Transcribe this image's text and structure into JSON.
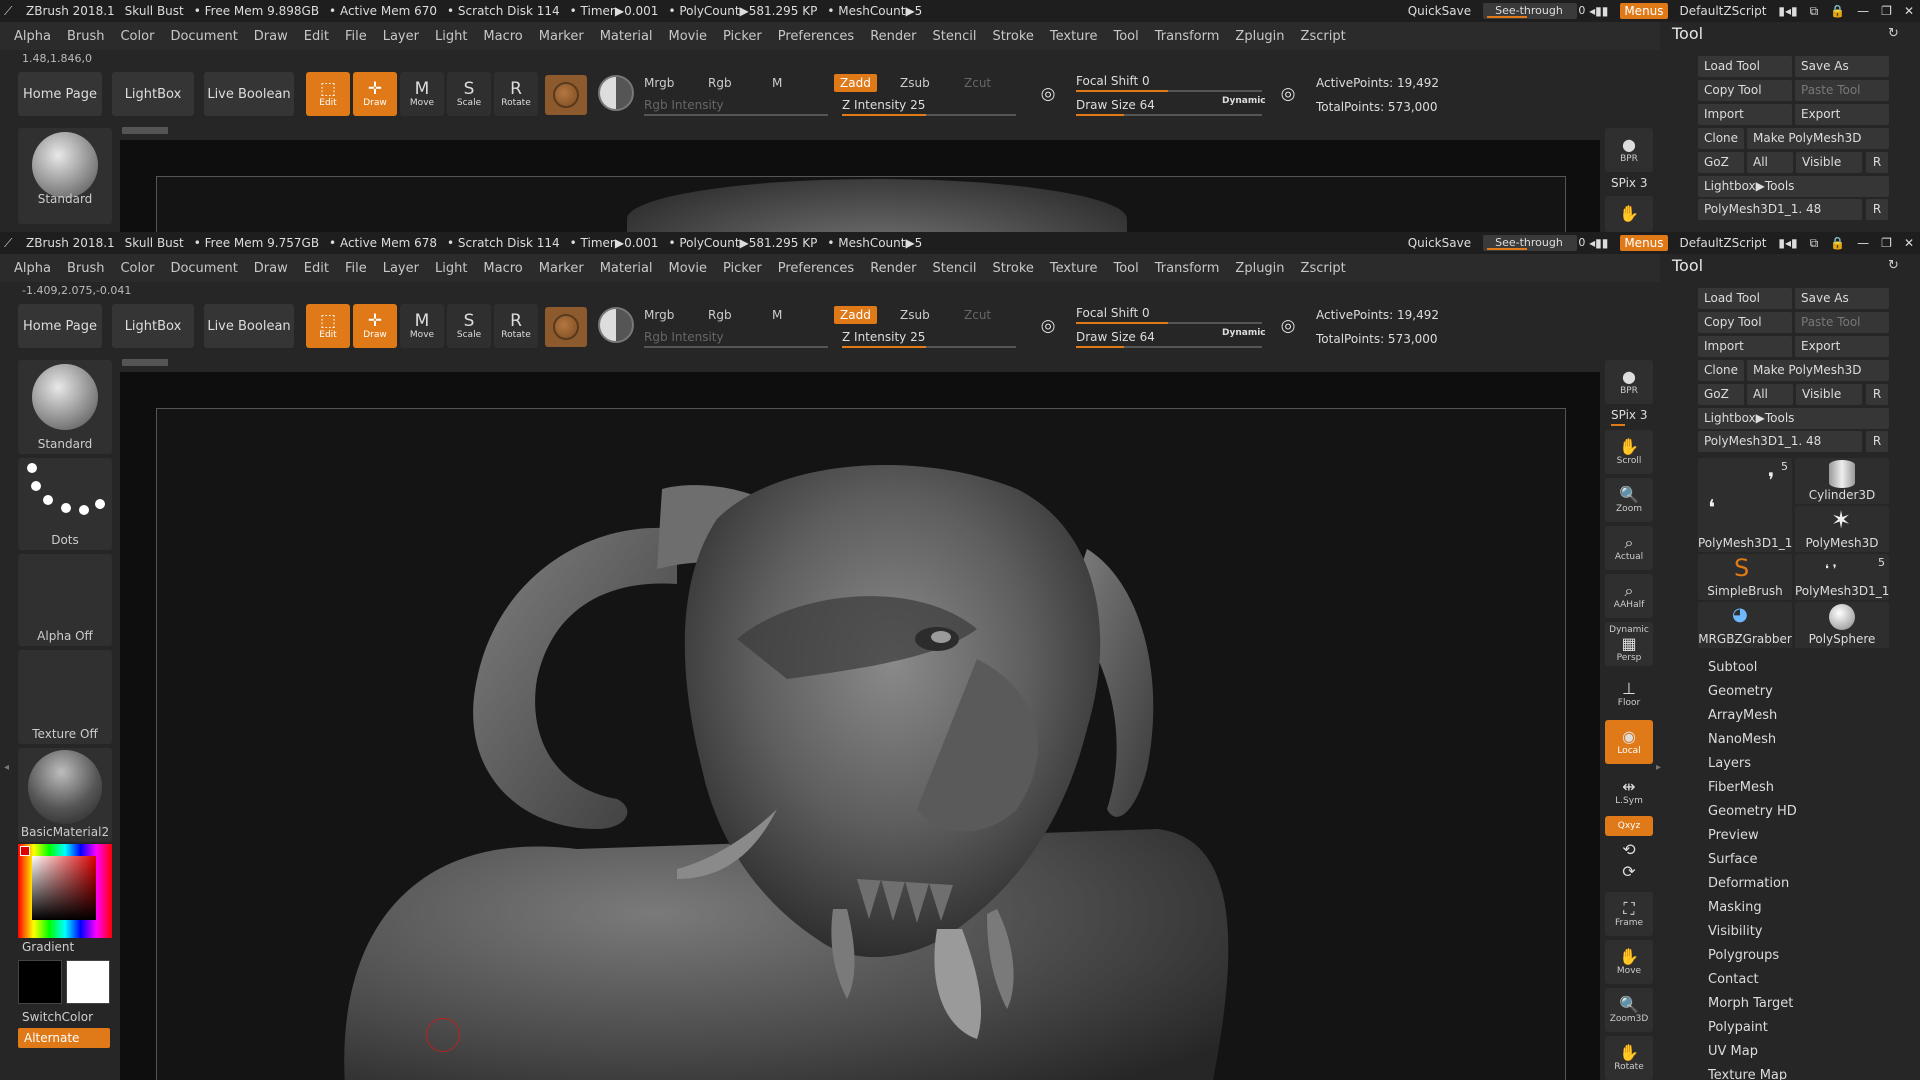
{
  "titlebar": {
    "app": "ZBrush 2018.1",
    "doc": "Skull Bust",
    "free_mem_top": "• Free Mem 9.898GB",
    "free_mem_bottom": "• Free Mem 9.757GB",
    "active_mem_top": "• Active Mem 670",
    "active_mem_bottom": "• Active Mem 678",
    "scratch": "• Scratch Disk 114",
    "timer": "• Timer▶0.001",
    "polycount": "• PolyCount▶581.295 KP",
    "meshcount": "• MeshCount▶5",
    "quicksave": "QuickSave",
    "seethrough_label": "See-through",
    "seethrough_value": "0",
    "menus": "Menus",
    "defaultzscript": "DefaultZScript"
  },
  "menubar": [
    "Alpha",
    "Brush",
    "Color",
    "Document",
    "Draw",
    "Edit",
    "File",
    "Layer",
    "Light",
    "Macro",
    "Marker",
    "Material",
    "Movie",
    "Picker",
    "Preferences",
    "Render",
    "Stencil",
    "Stroke",
    "Texture",
    "Tool",
    "Transform",
    "Zplugin",
    "Zscript"
  ],
  "coords": {
    "top": "1.48,1.846,0",
    "bottom": "-1.409,2.075,-0.041"
  },
  "toolbar": {
    "home": "Home Page",
    "lightbox": "LightBox",
    "liveboolean": "Live Boolean",
    "edit": "Edit",
    "draw": "Draw",
    "move": "Move",
    "scale": "Scale",
    "rotate": "Rotate",
    "mrgb": "Mrgb",
    "rgb": "Rgb",
    "m": "M",
    "zadd": "Zadd",
    "zsub": "Zsub",
    "zcut": "Zcut",
    "rgb_intensity": "Rgb Intensity",
    "z_intensity": "Z Intensity 25",
    "z_intensity_value": 25,
    "focal_shift": "Focal Shift 0",
    "draw_size": "Draw Size 64",
    "draw_size_value": 64,
    "dynamic": "Dynamic",
    "active_points": "ActivePoints: 19,492",
    "total_points": "TotalPoints: 573,000"
  },
  "left_shelf": {
    "standard": "Standard",
    "dots": "Dots",
    "alpha_off": "Alpha Off",
    "texture_off": "Texture Off",
    "basic_material": "BasicMaterial2",
    "gradient": "Gradient",
    "switchcolor": "SwitchColor",
    "alternate": "Alternate"
  },
  "right_shelf": {
    "bpr": "BPR",
    "spix": "SPix 3",
    "scroll": "Scroll",
    "zoom": "Zoom",
    "actual": "Actual",
    "aahalf": "AAHalf",
    "dynamic": "Dynamic",
    "persp": "Persp",
    "floor": "Floor",
    "local": "Local",
    "lsym": "L.Sym",
    "xyz": "Qxyz",
    "frame": "Frame",
    "move": "Move",
    "zoom3d": "Zoom3D",
    "rotate": "Rotate"
  },
  "tool_palette": {
    "title": "Tool",
    "load_tool": "Load Tool",
    "save_as": "Save As",
    "copy_tool": "Copy Tool",
    "paste_tool": "Paste Tool",
    "import": "Import",
    "export": "Export",
    "clone": "Clone",
    "make_polymesh": "Make PolyMesh3D",
    "goz": "GoZ",
    "all": "All",
    "visible": "Visible",
    "r": "R",
    "lightbox_tools": "Lightbox▶Tools",
    "current_tool": "PolyMesh3D1_1. 48",
    "tools": [
      {
        "name": "PolyMesh3D1_1",
        "count": "5"
      },
      {
        "name": "Cylinder3D",
        "count": ""
      },
      {
        "name": "PolyMesh3D",
        "count": ""
      },
      {
        "name": "SimpleBrush",
        "count": ""
      },
      {
        "name": "PolyMesh3D1_1",
        "count": "5"
      },
      {
        "name": "MRGBZGrabber",
        "count": ""
      },
      {
        "name": "PolySphere",
        "count": ""
      }
    ],
    "submenus": [
      "Subtool",
      "Geometry",
      "ArrayMesh",
      "NanoMesh",
      "Layers",
      "FiberMesh",
      "Geometry HD",
      "Preview",
      "Surface",
      "Deformation",
      "Masking",
      "Visibility",
      "Polygroups",
      "Contact",
      "Morph Target",
      "Polypaint",
      "UV Map",
      "Texture Map"
    ]
  }
}
